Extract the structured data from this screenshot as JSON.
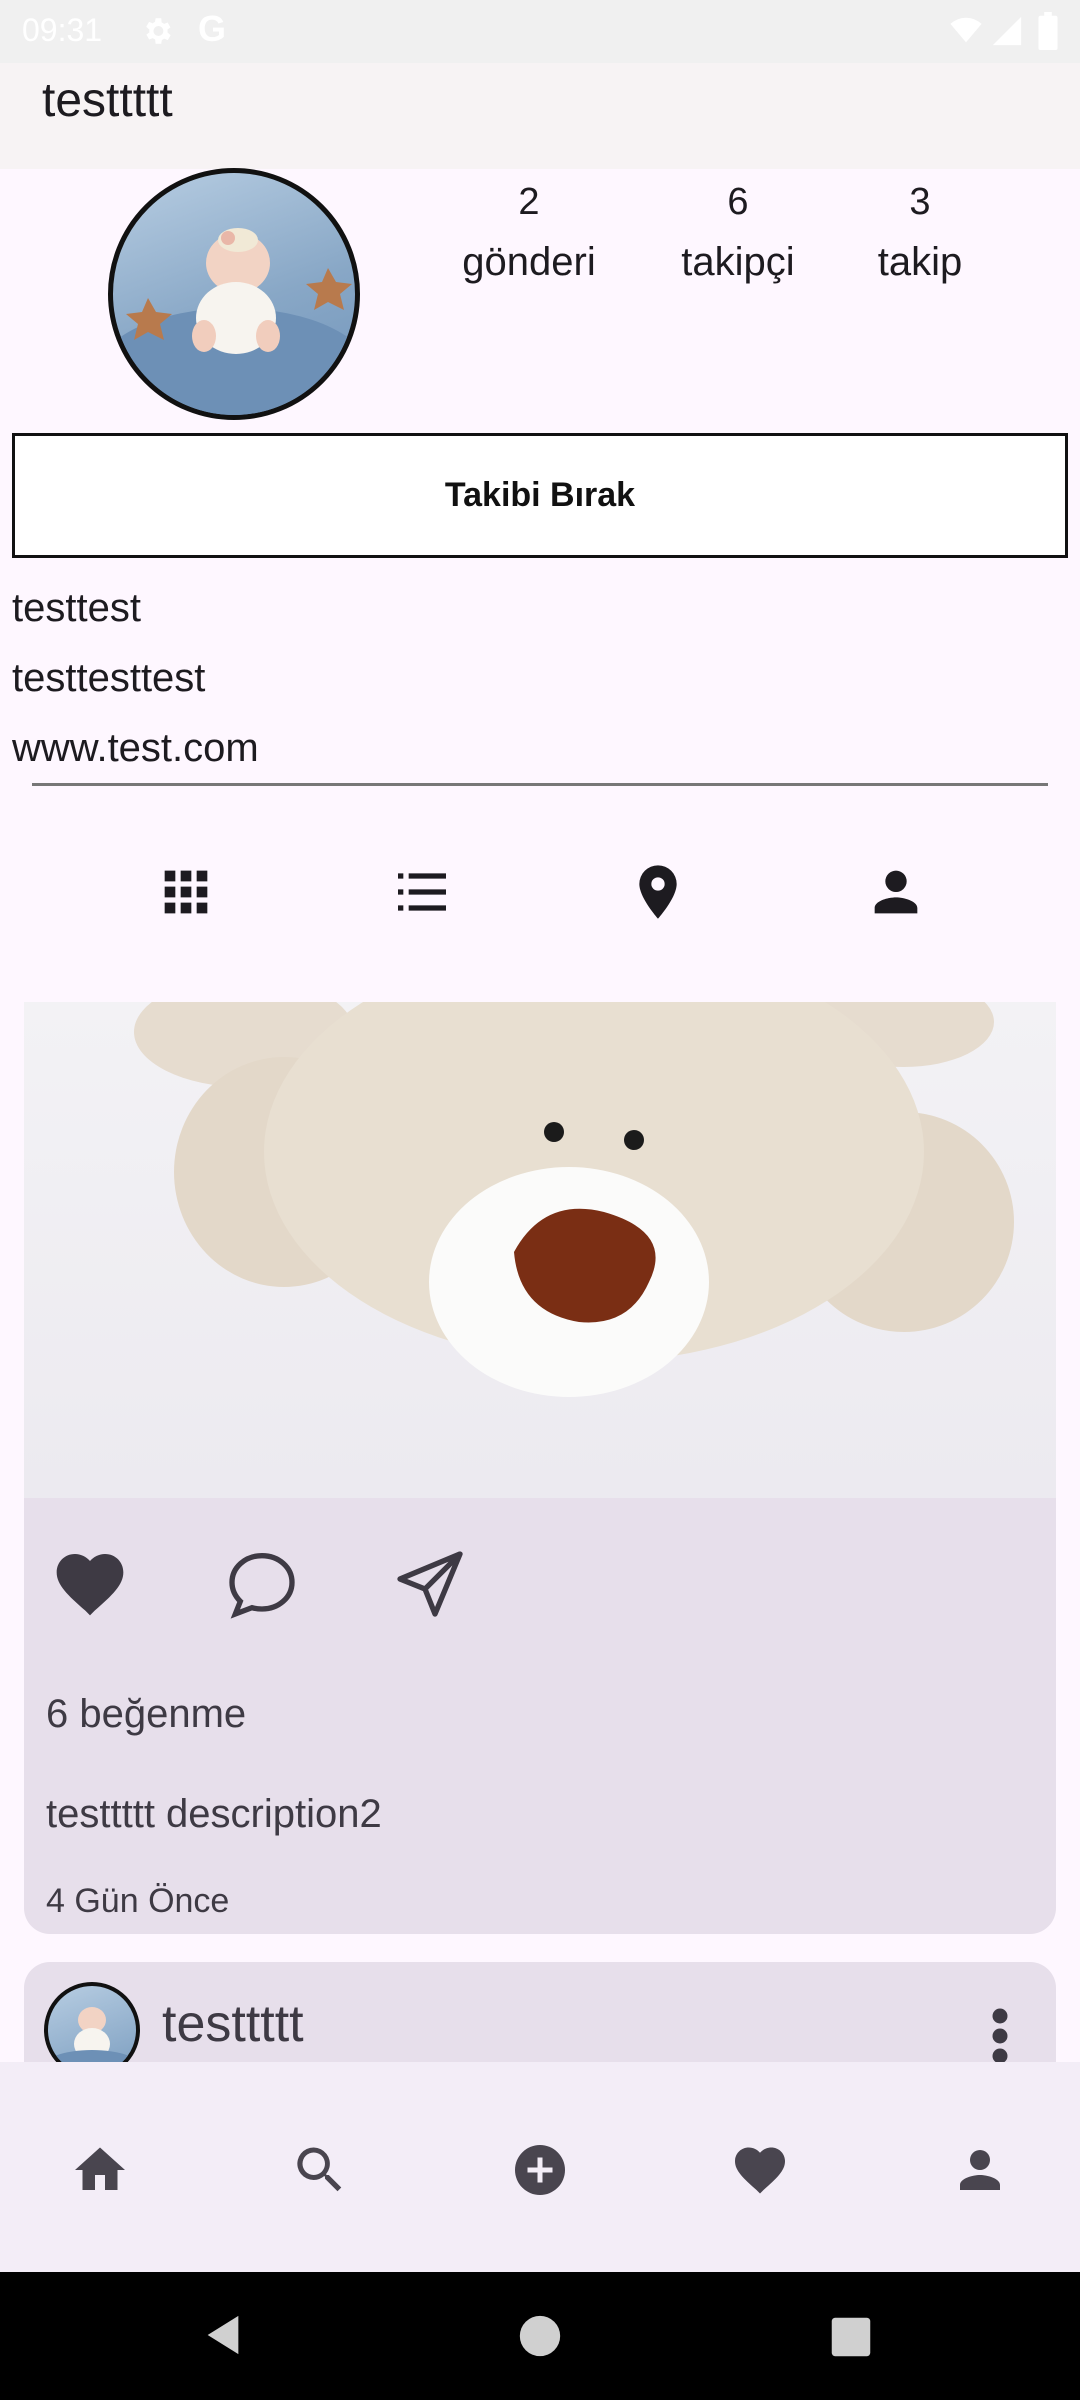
{
  "status_bar": {
    "time": "09:31",
    "google_label": "G",
    "icons": [
      "settings-icon",
      "wifi-icon",
      "signal-icon",
      "battery-icon"
    ]
  },
  "app_bar": {
    "title": "testtttt"
  },
  "profile": {
    "stats": [
      {
        "count": "2",
        "label": "gönderi"
      },
      {
        "count": "6",
        "label": "takipçi"
      },
      {
        "count": "3",
        "label": "takip"
      }
    ],
    "unfollow_label": "Takibi Bırak",
    "bio_lines": [
      "testtest",
      "testtesttest",
      "www.test.com"
    ]
  },
  "tabs": [
    "grid-icon",
    "list-icon",
    "location-pin-icon",
    "person-icon"
  ],
  "post": {
    "likes_text": "6 beğenme",
    "caption": "testtttt description2",
    "time_ago": "4 Gün Önce",
    "actions": [
      "heart-icon",
      "comment-icon",
      "send-icon"
    ]
  },
  "next_post": {
    "username": "testtttt"
  },
  "bottom_nav": [
    "home-icon",
    "search-icon",
    "add-circle-icon",
    "heart-icon",
    "person-icon"
  ],
  "colors": {
    "background": "#fef7ff",
    "card": "#e7dfeb",
    "bottom_nav": "#f3edf7",
    "text": "#1d1b20"
  }
}
